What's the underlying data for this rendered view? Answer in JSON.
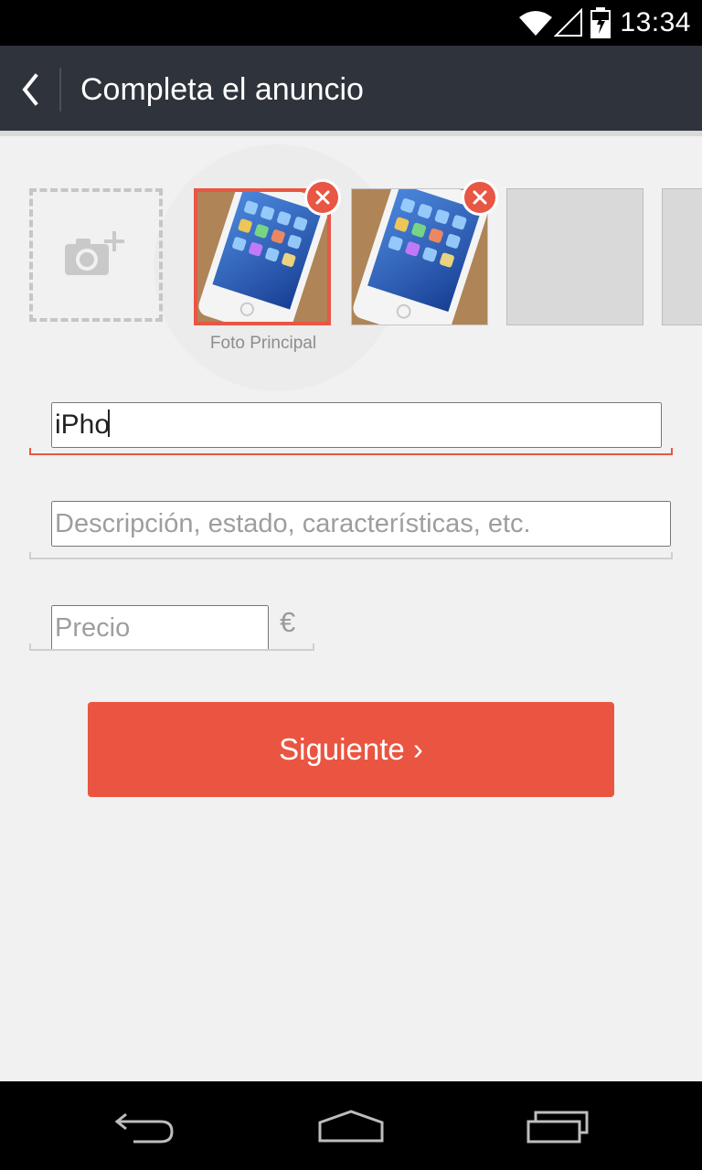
{
  "status_bar": {
    "time": "13:34",
    "icons": [
      "wifi-icon",
      "signal-icon",
      "battery-charging-icon"
    ]
  },
  "app_bar": {
    "back_icon": "chevron-left-icon",
    "title": "Completa el anuncio"
  },
  "photos": {
    "add_icon": "camera-plus-icon",
    "main_caption": "Foto Principal",
    "thumbnails": [
      "photo-1",
      "photo-2",
      "empty-slot",
      "empty-slot"
    ],
    "remove_icon": "close-icon"
  },
  "form": {
    "title_value": "iPho",
    "description_placeholder": "Descripción, estado, características, etc.",
    "price_placeholder": "Precio",
    "currency_symbol": "€"
  },
  "actions": {
    "next_label": "Siguiente ›"
  },
  "nav_bar": {
    "icons": [
      "back-icon",
      "home-icon",
      "recents-icon"
    ]
  },
  "colors": {
    "accent": "#ea5541",
    "appbar": "#2f333b",
    "background": "#f1f1f1"
  }
}
